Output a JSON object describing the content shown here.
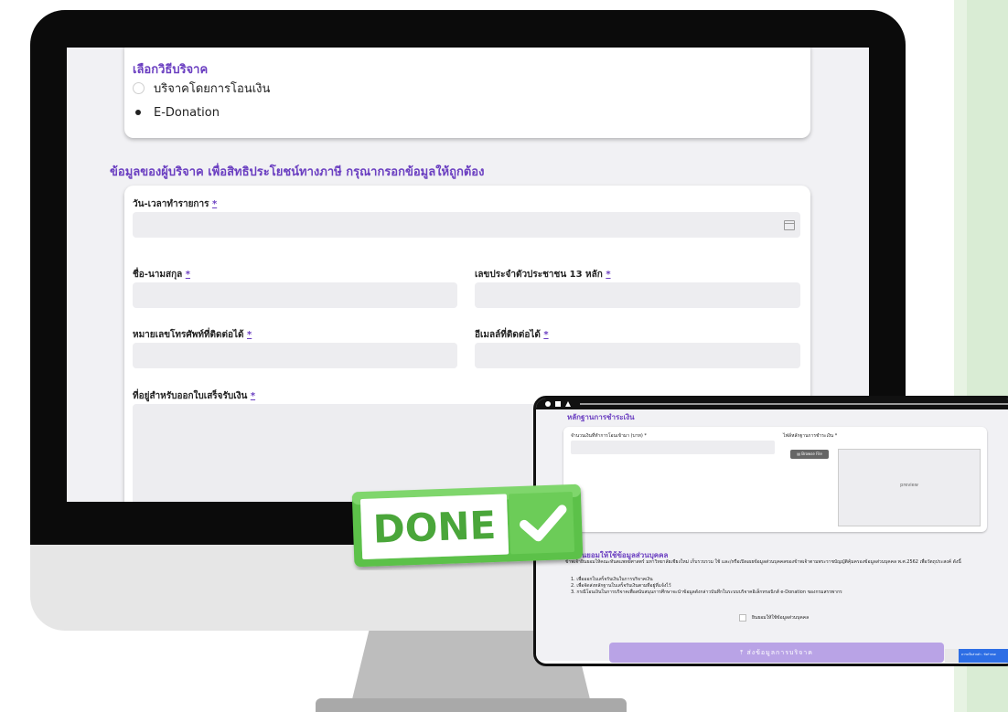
{
  "donation_method": {
    "title": "เลือกวิธีบริจาค",
    "options": [
      {
        "label": "บริจาคโดยการโอนเงิน",
        "selected": false
      },
      {
        "label": "E-Donation",
        "selected": true
      }
    ]
  },
  "donor_section_title": "ข้อมูลของผู้บริจาค เพื่อสิทธิประโยชน์ทางภาษี กรุณากรอกข้อมูลให้ถูกต้อง",
  "form": {
    "required_mark": "*",
    "datetime_label": "วัน-เวลาทำรายการ",
    "name_label": "ชื่อ-นามสกุล",
    "id_label": "เลขประจำตัวประชาชน 13 หลัก",
    "phone_label": "หมายเลขโทรศัพท์ที่ติดต่อได้",
    "email_label": "อีเมลล์ที่ติดต่อได้",
    "address_label": "ที่อยู่สำหรับออกใบเสร็จรับเงิน"
  },
  "overlay": {
    "section_title": "หลักฐานการชำระเงิน",
    "amount_label": "จำนวนเงินที่ทำการโอนเข้ามา (บาท) *",
    "attach_label": "ไฟล์หลักฐานการชำระเงิน *",
    "browse_label": "Browse File",
    "preview_label": "preview",
    "consent_title": "ยินยอมให้ใช้ข้อมูลส่วนบุคคล",
    "consent_text": "ข้าพเจ้ายินยอมให้คณะทันตแพทยศาสตร์ มหาวิทยาลัยเชียงใหม่ เก็บรวบรวม ใช้ และ/หรือเปิดเผยข้อมูลส่วนบุคคลของข้าพเจ้าตามพระราชบัญญัติคุ้มครองข้อมูลส่วนบุคคล พ.ศ.2562 เพื่อวัตถุประสงค์ ดังนี้",
    "consent_items": [
      "1. เพื่อออกใบเสร็จรับเงินในการบริจาคเงิน",
      "2. เพื่อจัดส่งหลักฐานใบเสร็จรับเงินตามที่อยู่ที่แจ้งไว้",
      "3. กรณีโอนเงินในการบริจาคเพื่อสนับสนุนการศึกษาจะนำข้อมูลดังกล่าวบันทึกในระบบบริจาคอิเล็กทรอนิกส์ e-Donation ของกรมสรรพากร"
    ],
    "consent_checkbox": "ยินยอมให้ใช้ข้อมูลส่วนบุคคล",
    "submit_label": "ส่งข้อมูลการบริจาค",
    "recaptcha_label": "ความเป็นส่วนตัว - ข้อกำหนด"
  },
  "badge": {
    "text": "DONE"
  },
  "colors": {
    "accent": "#6b3fc1",
    "badge_green": "#5cc14a",
    "submit": "#b9a3e6"
  }
}
